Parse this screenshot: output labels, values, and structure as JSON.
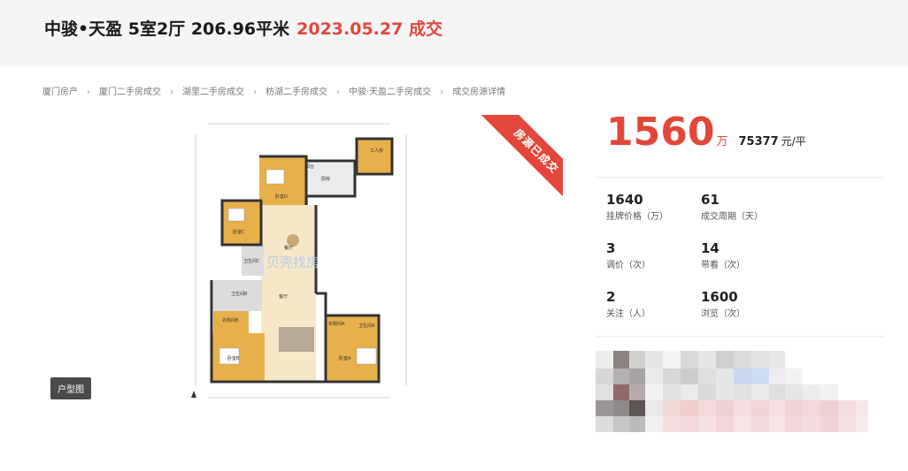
{
  "header": {
    "title": "中骏•天盈 5室2厅 206.96平米",
    "deal": "2023.05.27 成交"
  },
  "breadcrumb": [
    "厦门房产",
    "厦门二手房成交",
    "湖里二手房成交",
    "枋湖二手房成交",
    "中骏·天盈二手房成交",
    "成交房源详情"
  ],
  "floorplan": {
    "button_label": "户型图",
    "watermark": "贝壳找房",
    "rooms": [
      "卧室D",
      "厨房",
      "阳台",
      "卧室C",
      "卫生间C",
      "卫生间B",
      "餐厅",
      "客厅",
      "衣帽间B",
      "卧室B",
      "衣帽间A",
      "卧室A",
      "卫生间A",
      "工人房"
    ]
  },
  "sold_ribbon": "房源已成交",
  "price": {
    "total": "1560",
    "unit": "万",
    "unit_price": "75377",
    "unit_price_unit": "元/平"
  },
  "stats": [
    {
      "value": "1640",
      "label": "挂牌价格（万）"
    },
    {
      "value": "61",
      "label": "成交周期（天）"
    },
    {
      "value": "3",
      "label": "调价（次）"
    },
    {
      "value": "14",
      "label": "带看（次）"
    },
    {
      "value": "2",
      "label": "关注（人）"
    },
    {
      "value": "1600",
      "label": "浏览（次）"
    }
  ],
  "colors": {
    "accent": "#e2473a",
    "header_bg": "#f5f5f5"
  }
}
